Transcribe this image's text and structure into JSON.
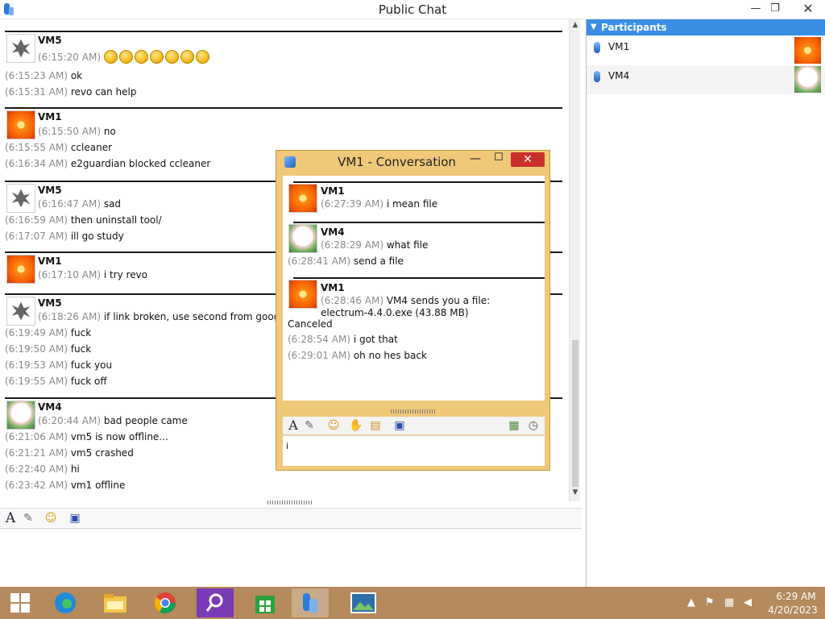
{
  "window": {
    "title": "Public Chat",
    "min": "—",
    "max": "❐",
    "close": "✕"
  },
  "chat": {
    "b1": {
      "sender": "VM5",
      "l1ts": "(6:15:20 AM)",
      "l2ts": "(6:15:23 AM)",
      "l2": "ok",
      "l3ts": "(6:15:31 AM)",
      "l3": "revo can help"
    },
    "b2": {
      "sender": "VM1",
      "l1ts": "(6:15:50 AM)",
      "l1": "no",
      "l2ts": "(6:15:55 AM)",
      "l2": "ccleaner",
      "l3ts": "(6:16:34 AM)",
      "l3": "e2guardian blocked ccleaner"
    },
    "b3": {
      "sender": "VM5",
      "l1ts": "(6:16:47 AM)",
      "l1": "sad",
      "l2ts": "(6:16:59 AM)",
      "l2": "then uninstall tool/",
      "l3ts": "(6:17:07 AM)",
      "l3": "ill go study"
    },
    "b4": {
      "sender": "VM1",
      "l1ts": "(6:17:10 AM)",
      "l1": "i try revo"
    },
    "b5": {
      "sender": "VM5",
      "l1ts": "(6:18:26 AM)",
      "l1": "if link broken, use second from google",
      "l2ts": "(6:19:49 AM)",
      "l2": "fuck",
      "l3ts": "(6:19:50 AM)",
      "l3": "fuck",
      "l4ts": "(6:19:53 AM)",
      "l4": "fuck you",
      "l5ts": "(6:19:55 AM)",
      "l5": "fuck off"
    },
    "b6": {
      "sender": "VM4",
      "l1ts": "(6:20:44 AM)",
      "l1": "bad people came",
      "l2ts": "(6:21:06 AM)",
      "l2": "vm5 is now offline...",
      "l3ts": "(6:21:21 AM)",
      "l3": "vm5 crashed",
      "l4ts": "(6:22:40 AM)",
      "l4": "hi",
      "l5ts": "(6:23:42 AM)",
      "l5": "vm1 offline"
    }
  },
  "participants": {
    "header": "Participants",
    "items": [
      {
        "name": "VM1"
      },
      {
        "name": "VM4"
      }
    ]
  },
  "conv": {
    "title": "VM1 - Conversation",
    "min": "—",
    "max": "☐",
    "close": "✕",
    "b1": {
      "sender": "VM1",
      "l1ts": "(6:27:39 AM)",
      "l1": "i mean file"
    },
    "b2": {
      "sender": "VM4",
      "l1ts": "(6:28:29 AM)",
      "l1": "what file",
      "l2ts": "(6:28:41 AM)",
      "l2": "send a file"
    },
    "b3": {
      "sender": "VM1",
      "l1ts": "(6:28:46 AM)",
      "l1": "VM4 sends you a file:",
      "l1b": "electrum-4.4.0.exe (43.88 MB)",
      "l1c": "Canceled",
      "l2ts": "(6:28:54 AM)",
      "l2": "i got that",
      "l3ts": "(6:29:01 AM)",
      "l3": "oh no hes back"
    },
    "input_value": "i"
  },
  "taskbar": {
    "time": "6:29 AM",
    "date": "4/20/2023"
  }
}
